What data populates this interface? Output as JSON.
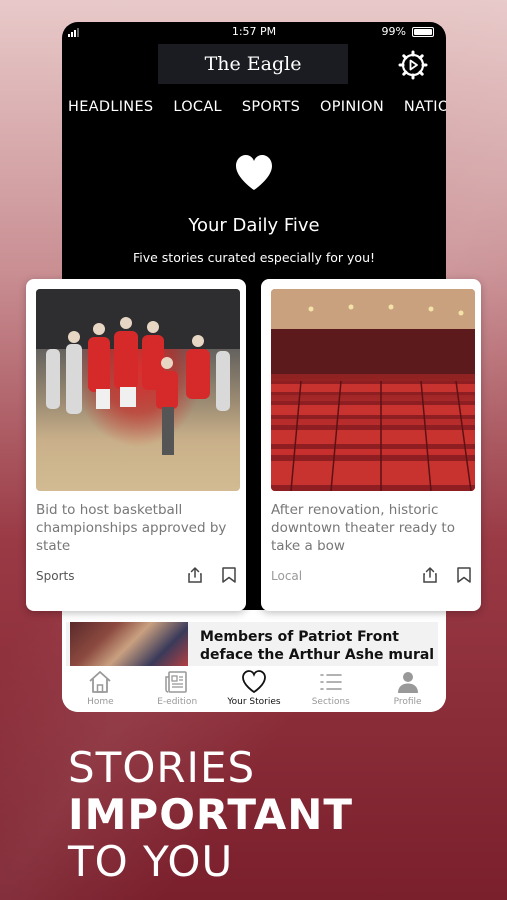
{
  "status": {
    "time": "1:57 PM",
    "battery": "99%"
  },
  "masthead": {
    "title": "The Eagle"
  },
  "nav": [
    "HEADLINES",
    "LOCAL",
    "SPORTS",
    "OPINION",
    "NATION"
  ],
  "daily": {
    "title": "Your Daily Five",
    "subtitle": "Five stories curated especially for you!"
  },
  "cards": [
    {
      "headline": "Bid to host basketball championships approved by state",
      "section": "Sports",
      "image": "basketball-team-celebration"
    },
    {
      "headline": "After renovation, historic downtown theater ready to take a bow",
      "section": "Local",
      "image": "theater-red-seats"
    }
  ],
  "preview_article": {
    "title": "Members of Patriot Front deface the Arthur Ashe mural in"
  },
  "tabbar": [
    {
      "label": "Home",
      "icon": "home-icon",
      "active": false
    },
    {
      "label": "E-edition",
      "icon": "newspaper-icon",
      "active": false
    },
    {
      "label": "Your Stories",
      "icon": "heart-icon",
      "active": true
    },
    {
      "label": "Sections",
      "icon": "list-icon",
      "active": false
    },
    {
      "label": "Profile",
      "icon": "person-icon",
      "active": false
    }
  ],
  "tagline": {
    "line1": "STORIES",
    "line2": "IMPORTANT",
    "line3": "TO YOU"
  },
  "colors": {
    "app_background": "#000000",
    "card_background": "#ffffff",
    "tab_active": "#111111",
    "tab_inactive": "#999999"
  }
}
